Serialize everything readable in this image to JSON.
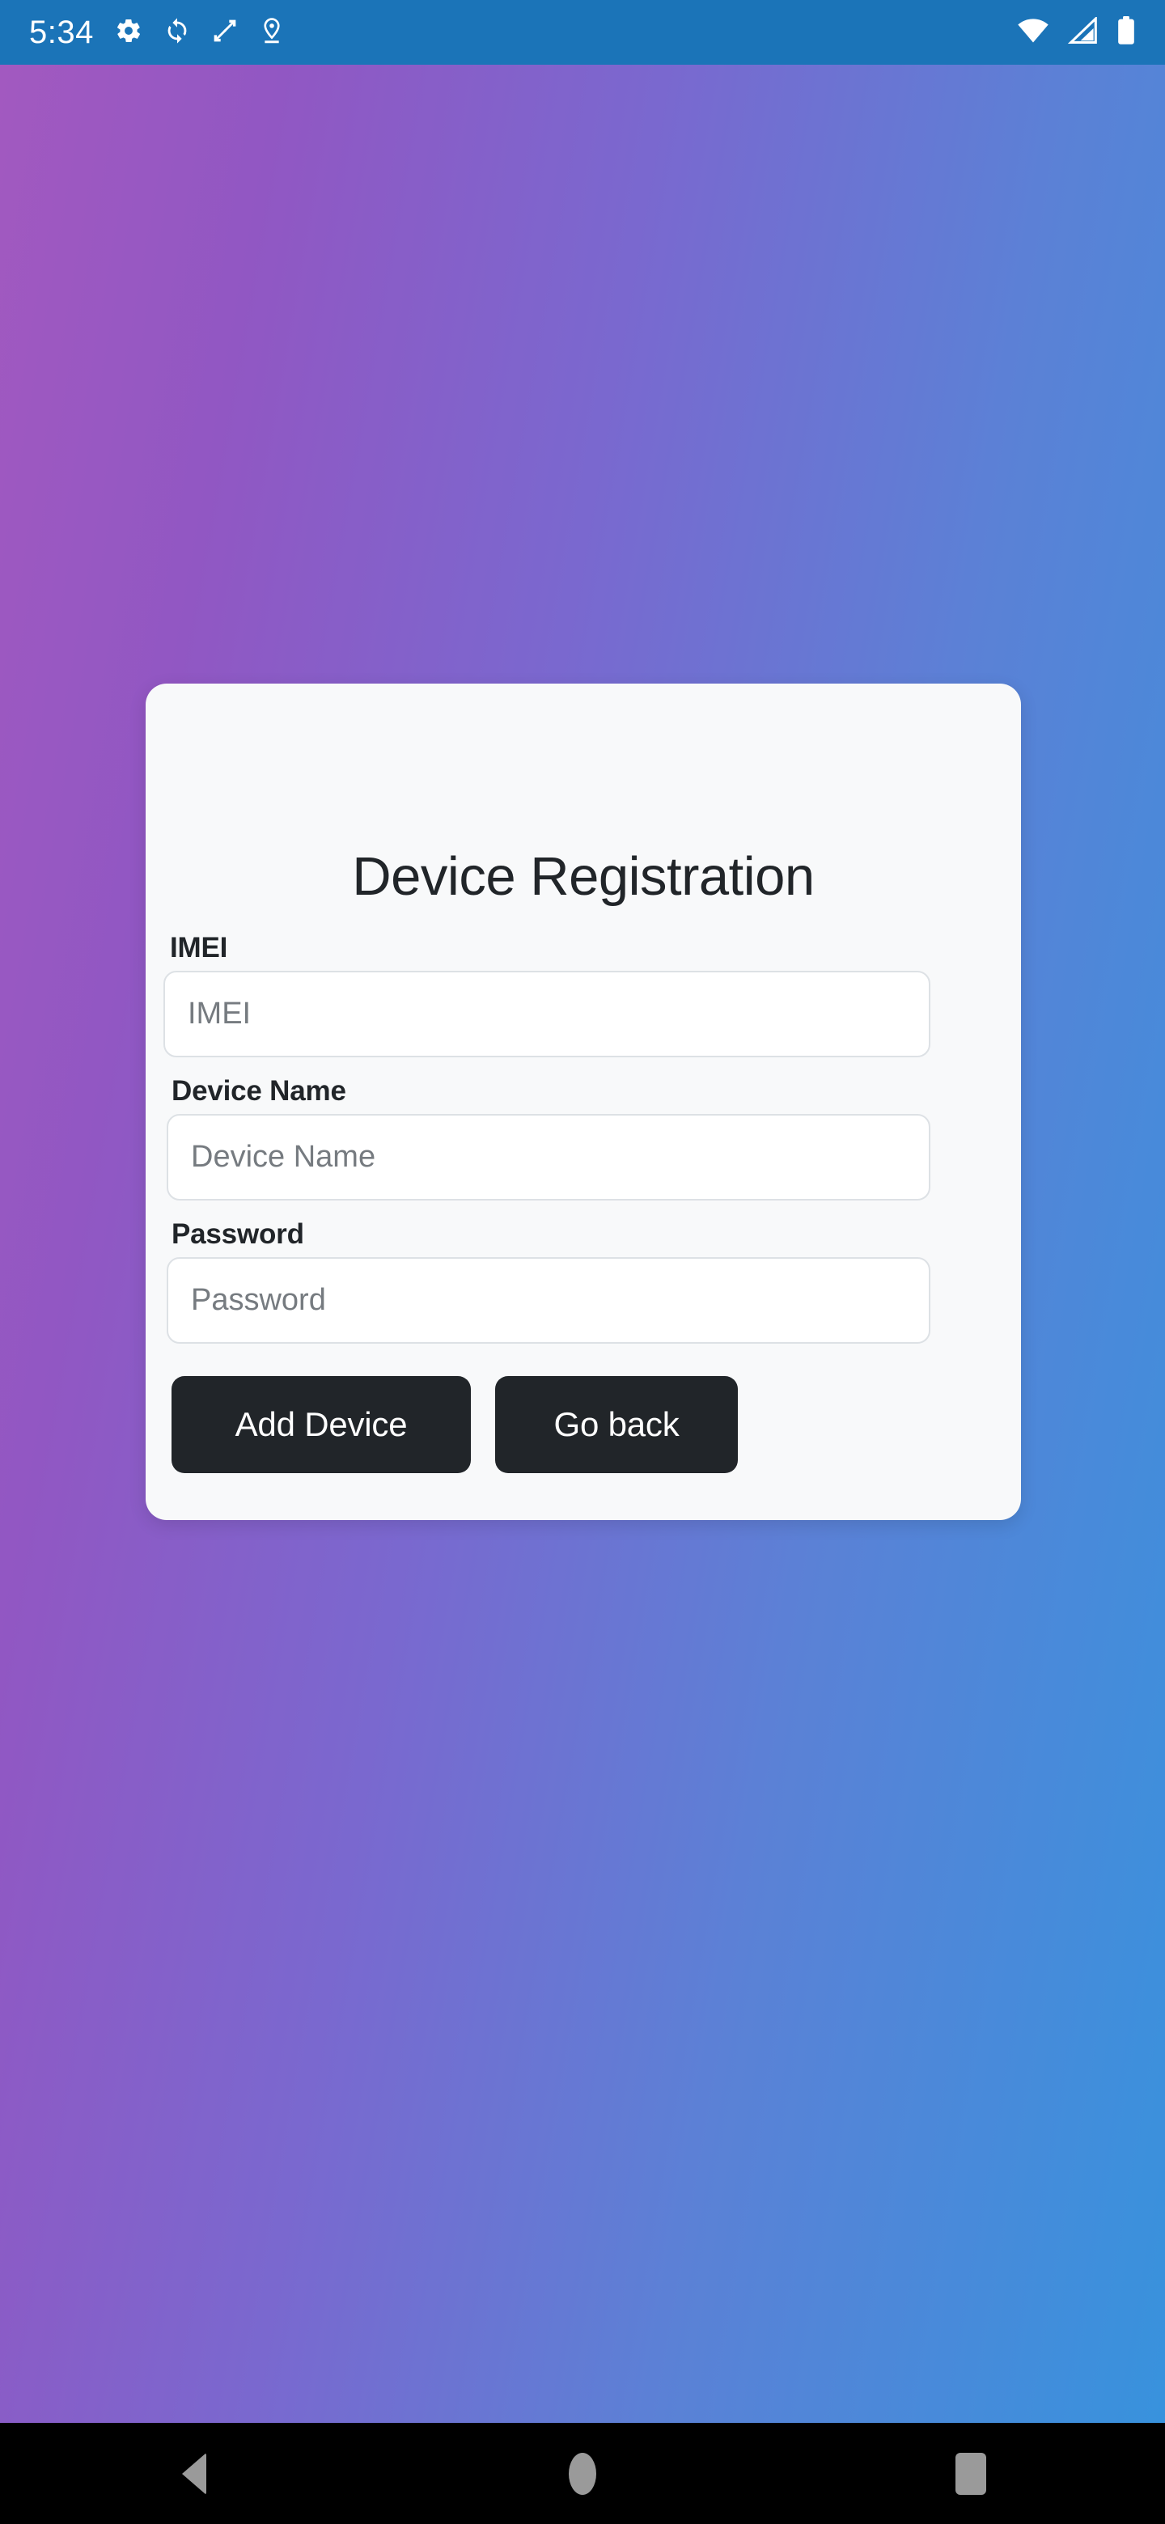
{
  "status_bar": {
    "time": "5:34",
    "left_icons": [
      "gear-icon",
      "sync-icon",
      "screen-rotate-icon",
      "location-pin-icon"
    ],
    "right_icons": [
      "wifi-icon",
      "cellular-signal-icon",
      "battery-icon"
    ],
    "background_color": "#1b74b8",
    "foreground_color": "#ffffff"
  },
  "wallpaper": {
    "gradient_start": "#a259c0",
    "gradient_end": "#3892dd"
  },
  "card": {
    "title": "Device Registration",
    "background_color": "#f8f9fa",
    "fields": [
      {
        "label": "IMEI",
        "placeholder": "IMEI",
        "value": "",
        "type": "text"
      },
      {
        "label": "Device Name",
        "placeholder": "Device Name",
        "value": "",
        "type": "text"
      },
      {
        "label": "Password",
        "placeholder": "Password",
        "value": "",
        "type": "password"
      }
    ],
    "buttons": [
      {
        "label": "Add Device",
        "color": "#212529"
      },
      {
        "label": "Go back",
        "color": "#212529"
      }
    ]
  },
  "nav_bar": {
    "background_color": "#000000",
    "icon_color": "#9a9a9a",
    "items": [
      {
        "name": "back",
        "icon": "triangle-left-icon"
      },
      {
        "name": "home",
        "icon": "circle-icon"
      },
      {
        "name": "recents",
        "icon": "square-icon"
      }
    ]
  }
}
